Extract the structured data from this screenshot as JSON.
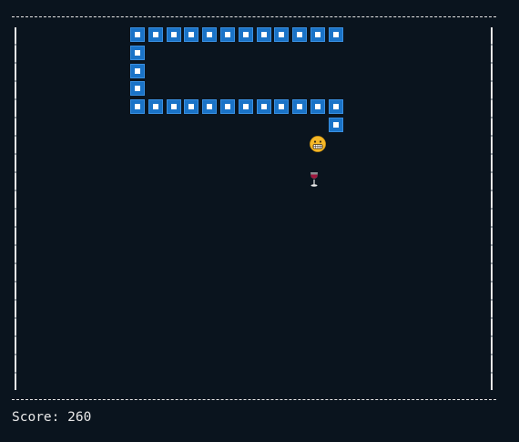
{
  "game": {
    "score_label": "Score: 260",
    "snake_color": "#1a73c7",
    "background_color": "#0a141e",
    "head_icon": "grinning-face-icon",
    "food_icon": "wine-glass-icon"
  }
}
